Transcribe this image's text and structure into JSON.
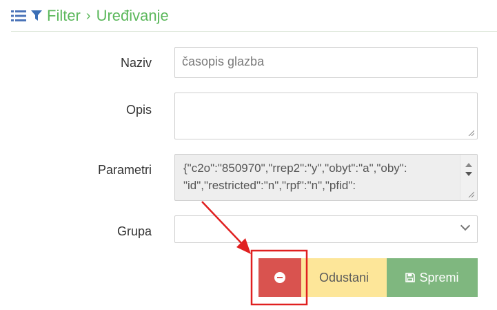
{
  "breadcrumb": {
    "root": "Filter",
    "separator": "›",
    "current": "Uređivanje"
  },
  "form": {
    "naziv": {
      "label": "Naziv",
      "value": "časopis glazba"
    },
    "opis": {
      "label": "Opis",
      "value": ""
    },
    "parametri": {
      "label": "Parametri",
      "line1": "{\"c2o\":\"850970\",\"rrep2\":\"y\",\"obyt\":\"a\",\"oby\":",
      "line2": "\"id\",\"restricted\":\"n\",\"rpf\":\"n\",\"pfid\":"
    },
    "grupa": {
      "label": "Grupa",
      "value": ""
    }
  },
  "buttons": {
    "cancel": "Odustani",
    "save": "Spremi"
  },
  "colors": {
    "accent": "#5cb85c",
    "delete": "#d9534f",
    "cancel_bg": "#fde699",
    "save_bg": "#7fb77f",
    "annotation": "#e02020"
  }
}
